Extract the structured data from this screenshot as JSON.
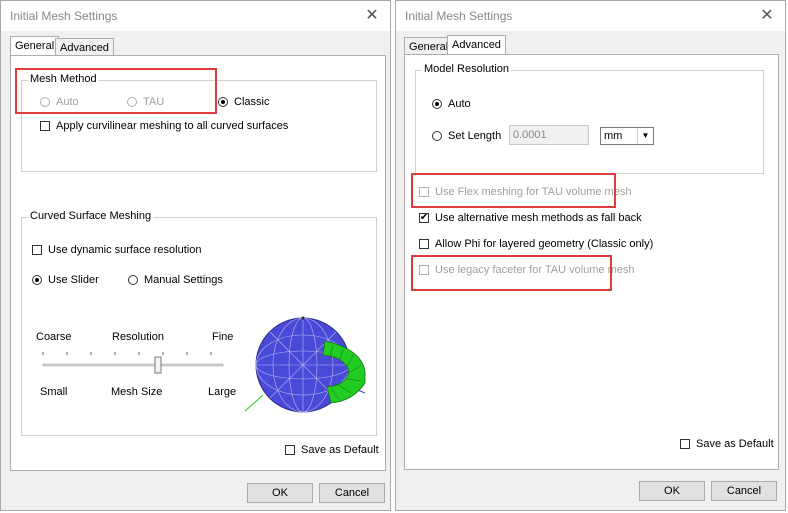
{
  "left": {
    "title": "Initial Mesh Settings",
    "tabs": [
      "General",
      "Advanced"
    ],
    "mesh_method": {
      "label": "Mesh Method",
      "auto": "Auto",
      "tau": "TAU",
      "classic": "Classic",
      "curvilinear": "Apply curvilinear meshing to all curved surfaces"
    },
    "curved": {
      "label": "Curved Surface Meshing",
      "dynamic": "Use dynamic surface resolution",
      "use_slider": "Use Slider",
      "manual": "Manual Settings",
      "coarse": "Coarse",
      "resolution": "Resolution",
      "fine": "Fine",
      "small": "Small",
      "mesh_size": "Mesh Size",
      "large": "Large"
    },
    "save_default": "Save as Default",
    "ok": "OK",
    "cancel": "Cancel"
  },
  "right": {
    "title": "Initial Mesh Settings",
    "tabs": [
      "General",
      "Advanced"
    ],
    "model_resolution": {
      "label": "Model Resolution",
      "auto": "Auto",
      "set_length": "Set Length",
      "length_value": "0.0001",
      "unit": "mm"
    },
    "flex": "Use Flex meshing for TAU volume mesh",
    "alternative": "Use alternative mesh methods as fall back",
    "allow_phi": "Allow Phi for layered geometry (Classic only)",
    "legacy": "Use legacy faceter for TAU volume mesh",
    "save_default": "Save as Default",
    "ok": "OK",
    "cancel": "Cancel"
  },
  "colors": {
    "highlight": "#e03c3c",
    "sphere": "#4a4ad8",
    "band": "#22cc22"
  }
}
